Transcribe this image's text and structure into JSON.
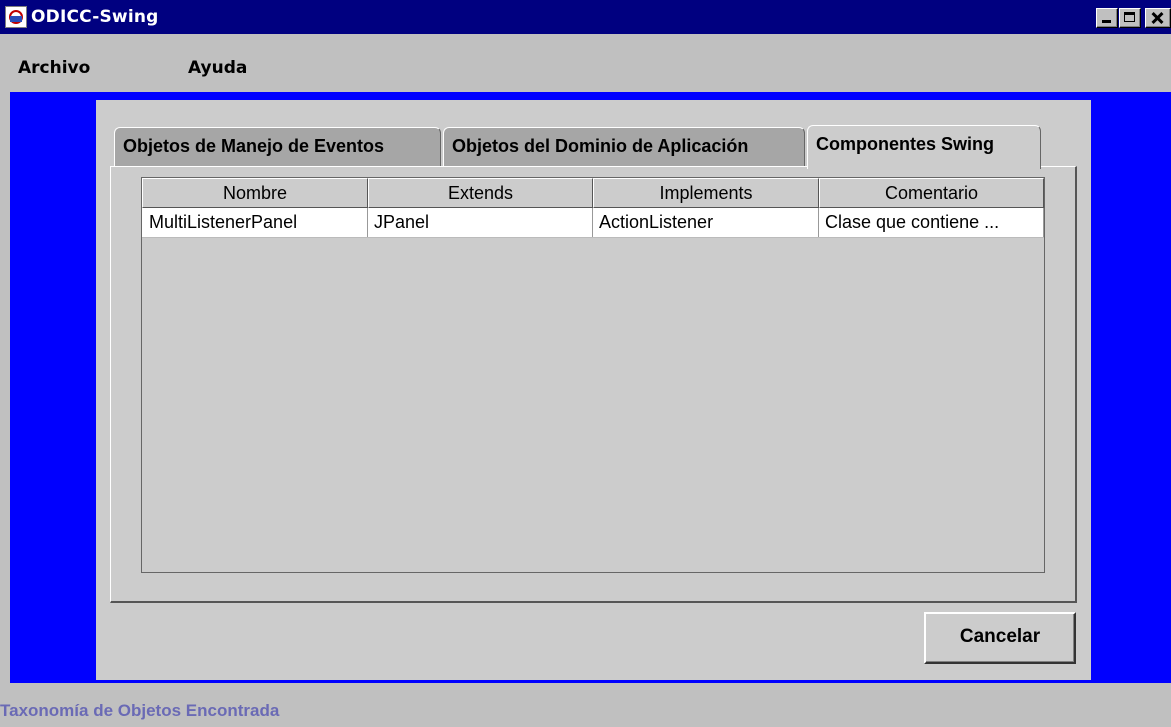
{
  "window": {
    "title": "ODICC-Swing",
    "icon": "java-app-icon"
  },
  "menu": {
    "items": [
      {
        "label": "Archivo"
      },
      {
        "label": "Ayuda"
      }
    ]
  },
  "tabs": [
    {
      "label": "Objetos de Manejo de Eventos",
      "active": false
    },
    {
      "label": "Objetos del Dominio de Aplicación",
      "active": false
    },
    {
      "label": "Componentes Swing",
      "active": true
    }
  ],
  "table": {
    "columns": [
      "Nombre",
      "Extends",
      "Implements",
      "Comentario"
    ],
    "rows": [
      [
        "MultiListenerPanel",
        "JPanel",
        "ActionListener",
        "Clase que contiene ..."
      ]
    ]
  },
  "buttons": {
    "cancel_label": "Cancelar"
  },
  "status": {
    "text": "Taxonomía de Objetos Encontrada"
  },
  "colors": {
    "titlebar": "#000080",
    "content_background": "#0000ff",
    "panel": "#cccccc",
    "status_text": "#6a6ab5"
  }
}
